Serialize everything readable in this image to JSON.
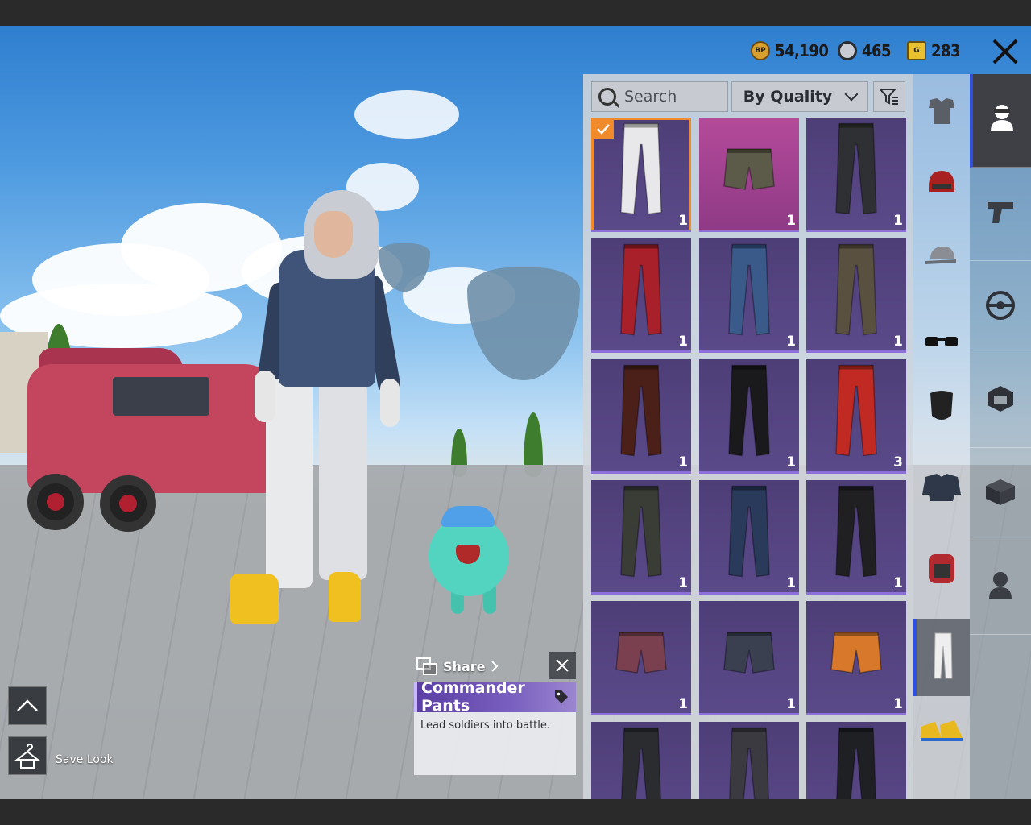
{
  "currencies": [
    {
      "icon": "bp-coin-icon",
      "icon_text": "BP",
      "value": "54,190",
      "color": "#e0a030"
    },
    {
      "icon": "silver-fragment-icon",
      "icon_text": "",
      "value": "465",
      "color": "#9a9ea4"
    },
    {
      "icon": "g-coin-icon",
      "icon_text": "G",
      "value": "283",
      "color": "#e8c030"
    }
  ],
  "toolbar": {
    "search_placeholder": "Search",
    "sort_label": "By Quality"
  },
  "items": [
    {
      "name": "white-pants",
      "count": "1",
      "selected": true,
      "color": "#e8e8ea"
    },
    {
      "name": "camo-shorts",
      "count": "1",
      "selected": false,
      "color": "#5c5a48"
    },
    {
      "name": "black-ripped-jeans",
      "count": "1",
      "selected": false,
      "color": "#2e3034"
    },
    {
      "name": "red-black-pants",
      "count": "1",
      "selected": false,
      "color": "#a8202a"
    },
    {
      "name": "blue-jeans",
      "count": "1",
      "selected": false,
      "color": "#3a5a8a"
    },
    {
      "name": "brown-cargo-pants",
      "count": "1",
      "selected": false,
      "color": "#5a5040"
    },
    {
      "name": "brown-leather-pants",
      "count": "1",
      "selected": false,
      "color": "#4a2018"
    },
    {
      "name": "black-leather-flares",
      "count": "1",
      "selected": false,
      "color": "#1a1a1c"
    },
    {
      "name": "red-pants",
      "count": "3",
      "selected": false,
      "color": "#c02a22"
    },
    {
      "name": "dark-camo-pants",
      "count": "1",
      "selected": false,
      "color": "#3a3c36"
    },
    {
      "name": "dark-blue-jeans",
      "count": "1",
      "selected": false,
      "color": "#2a3a5a"
    },
    {
      "name": "black-pants",
      "count": "1",
      "selected": false,
      "color": "#202022"
    },
    {
      "name": "plaid-skirt",
      "count": "1",
      "selected": false,
      "color": "#7a4050"
    },
    {
      "name": "black-mini-skirt",
      "count": "1",
      "selected": false,
      "color": "#3a4050"
    },
    {
      "name": "orange-shorts",
      "count": "1",
      "selected": false,
      "color": "#d8782a"
    },
    {
      "name": "tactical-pants",
      "count": "",
      "selected": false,
      "color": "#2a2c30"
    },
    {
      "name": "grey-pants",
      "count": "",
      "selected": false,
      "color": "#3a3a40"
    },
    {
      "name": "black-biker-pants",
      "count": "",
      "selected": false,
      "color": "#1e2024"
    }
  ],
  "categories": [
    {
      "name": "outfit-icon",
      "active": false
    },
    {
      "name": "helmet-icon",
      "active": false
    },
    {
      "name": "hat-icon",
      "active": false
    },
    {
      "name": "glasses-icon",
      "active": false
    },
    {
      "name": "mask-icon",
      "active": false
    },
    {
      "name": "jacket-icon",
      "active": false
    },
    {
      "name": "backpack-icon",
      "active": false
    },
    {
      "name": "pants-icon",
      "active": true
    },
    {
      "name": "shoes-icon",
      "active": false
    }
  ],
  "side_tabs": [
    {
      "name": "character-icon",
      "active": true
    },
    {
      "name": "gun-icon",
      "active": false
    },
    {
      "name": "steering-wheel-icon",
      "active": false
    },
    {
      "name": "emblem-icon",
      "active": false
    },
    {
      "name": "crate-icon",
      "active": false
    },
    {
      "name": "companion-icon",
      "active": false
    }
  ],
  "tooltip": {
    "share_label": "Share",
    "title": "Commander Pants",
    "description": "Lead soldiers into battle."
  },
  "controls": {
    "save_label": "Save Look"
  }
}
